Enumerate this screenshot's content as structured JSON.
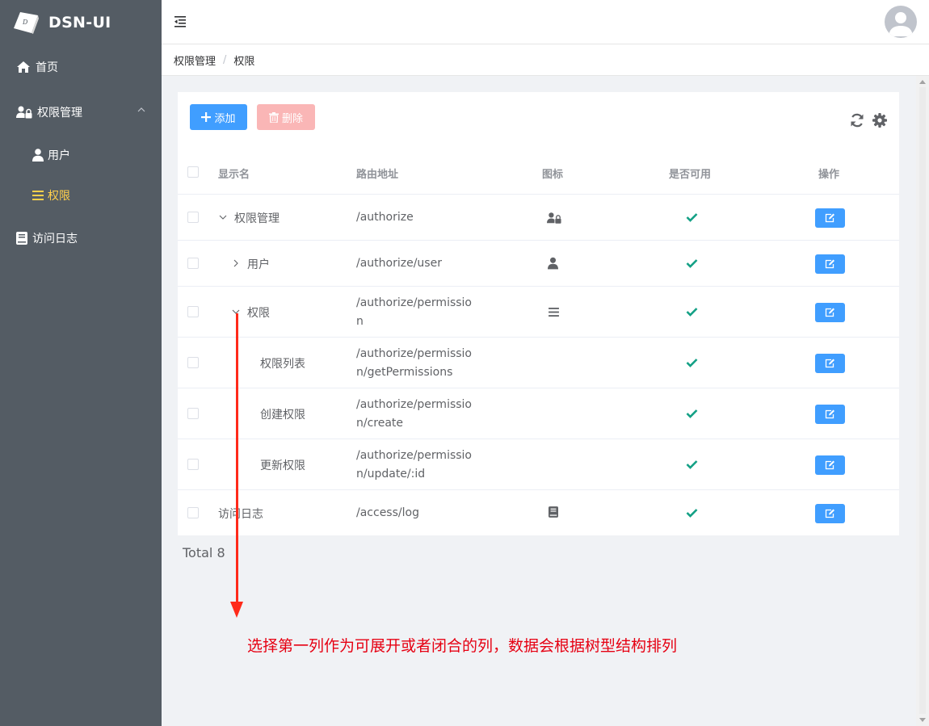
{
  "app": {
    "title": "DSN-UI"
  },
  "sidebar": {
    "items": [
      {
        "label": "首页",
        "icon": "home-icon"
      },
      {
        "label": "权限管理",
        "icon": "user-lock-icon",
        "expanded": true
      },
      {
        "label": "用户",
        "icon": "user-icon"
      },
      {
        "label": "权限",
        "icon": "bars-icon",
        "active": true
      },
      {
        "label": "访问日志",
        "icon": "book-icon"
      }
    ]
  },
  "breadcrumb": {
    "items": [
      "权限管理",
      "权限"
    ],
    "separator": "/"
  },
  "toolbar": {
    "add_label": "添加",
    "delete_label": "删除"
  },
  "table": {
    "columns": [
      "显示名",
      "路由地址",
      "图标",
      "是否可用",
      "操作"
    ],
    "rows": [
      {
        "name": "权限管理",
        "path": "/authorize",
        "icon": "user-lock-icon",
        "enabled": true,
        "expand": "open"
      },
      {
        "name": "用户",
        "path": "/authorize/user",
        "icon": "user-icon",
        "enabled": true,
        "expand": "closed"
      },
      {
        "name": "权限",
        "path": "/authorize/permission",
        "icon": "bars-icon",
        "enabled": true,
        "expand": "open"
      },
      {
        "name": "权限列表",
        "path": "/authorize/permission/getPermissions",
        "icon": "",
        "enabled": true,
        "expand": "none"
      },
      {
        "name": "创建权限",
        "path": "/authorize/permission/create",
        "icon": "",
        "enabled": true,
        "expand": "none"
      },
      {
        "name": "更新权限",
        "path": "/authorize/permission/update/:id",
        "icon": "",
        "enabled": true,
        "expand": "none"
      },
      {
        "name": "访问日志",
        "path": "/access/log",
        "icon": "book-icon",
        "enabled": true,
        "expand": "none"
      }
    ]
  },
  "pagination": {
    "total_label": "Total 8"
  },
  "annotation": {
    "text": "选择第一列作为可展开或者闭合的列，数据会根据树型结构排列"
  },
  "colors": {
    "sidebar_bg": "#545c64",
    "active": "#ffd04b",
    "primary": "#409eff",
    "danger_light": "#fab6b6",
    "success": "#13a085",
    "annotation": "#e60012"
  }
}
